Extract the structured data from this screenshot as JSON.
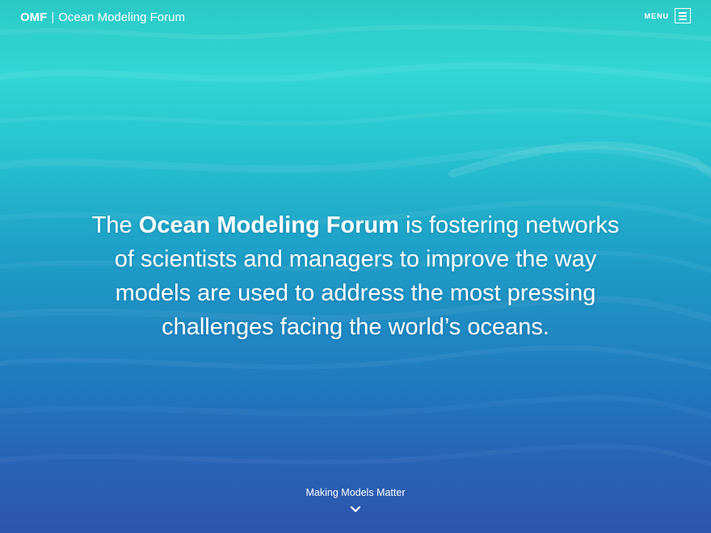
{
  "header": {
    "brand_abbr": "OMF",
    "brand_separator": "|",
    "brand_name": "Ocean Modeling Forum",
    "menu_label": "MENU",
    "menu_icon": "hamburger-icon"
  },
  "hero": {
    "before": "The ",
    "emphasis": "Ocean Modeling Forum",
    "after": " is fostering networks of scientists and managers to improve the way models are used to address the most pressing challenges facing the world’s oceans."
  },
  "footer": {
    "tagline": "Making Models Matter",
    "scroll_icon": "chevron-down-icon"
  },
  "colors": {
    "text": "#ffffff",
    "sky_teal": "#32d6d6",
    "mid_blue": "#1f8cc3",
    "deep_blue": "#2d56ad"
  }
}
